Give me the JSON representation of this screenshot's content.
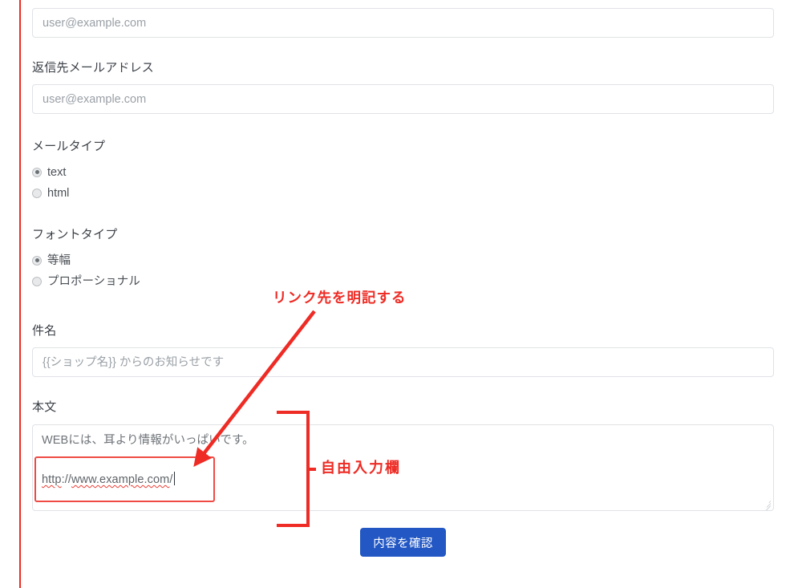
{
  "page": {
    "accent_red": "#ee2b24",
    "button_blue": "#2257c4",
    "border_gray": "#dfe2e6"
  },
  "form": {
    "sender_email": {
      "label": "",
      "placeholder": "user@example.com",
      "value": ""
    },
    "reply_to_email": {
      "label": "返信先メールアドレス",
      "placeholder": "user@example.com",
      "value": ""
    },
    "mail_type": {
      "label": "メールタイプ",
      "options": [
        {
          "label": "text",
          "checked": true
        },
        {
          "label": "html",
          "checked": false
        }
      ]
    },
    "font_type": {
      "label": "フォントタイプ",
      "options": [
        {
          "label": "等幅",
          "checked": true
        },
        {
          "label": "プロポーショナル",
          "checked": false
        }
      ]
    },
    "subject": {
      "label": "件名",
      "placeholder": "{{ショップ名}} からのお知らせです",
      "value": ""
    },
    "body": {
      "label": "本文",
      "line1": "WEBには、耳より情報がいっぱいです。",
      "url_text": "http://www.example.com/",
      "url_scheme": "http",
      "url_host": "www.example.com"
    },
    "submit": {
      "label": "内容を確認"
    }
  },
  "annotations": {
    "link_note": "リンク先を明記する",
    "free_input_note": "自由入力欄"
  }
}
